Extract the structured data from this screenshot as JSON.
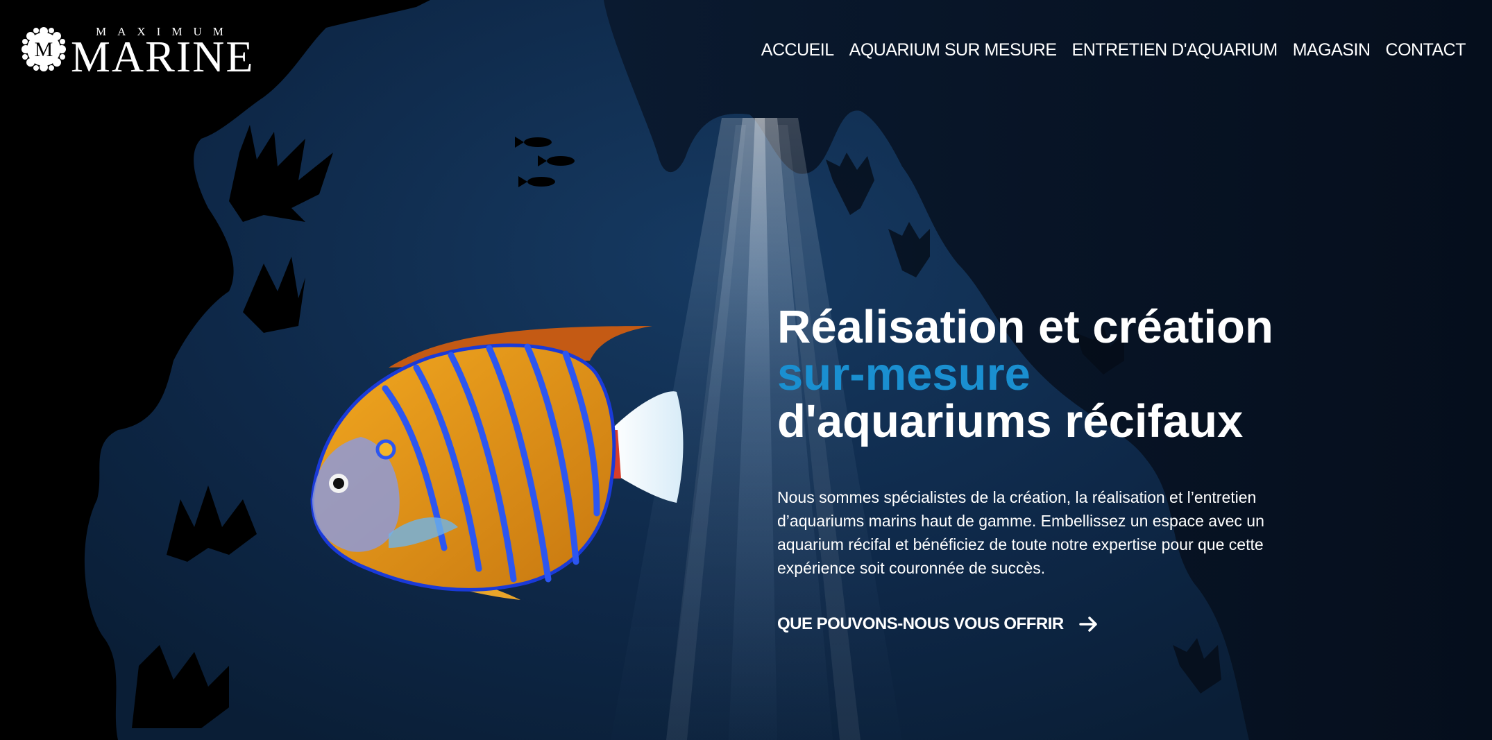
{
  "brand": {
    "small": "MAXIMUM",
    "name": "MARINE",
    "emblem_letter": "M"
  },
  "nav": {
    "items": [
      {
        "label": "ACCUEIL"
      },
      {
        "label": "AQUARIUM SUR MESURE"
      },
      {
        "label": "ENTRETIEN D'AQUARIUM"
      },
      {
        "label": "MAGASIN"
      },
      {
        "label": "CONTACT"
      }
    ]
  },
  "hero": {
    "line1": "Réalisation et création",
    "line2": "sur-mesure",
    "line3": "d'aquariums récifaux",
    "description": "Nous sommes spécialistes de la création, la réalisation et l’entretien d’aquariums marins haut de gamme. Embellissez un espace avec un aquarium récifal et bénéficiez de toute notre expertise pour que cette expérience soit couronnée de succès.",
    "cta": "QUE POUVONS-NOUS VOUS OFFRIR",
    "cta_icon": "arrow-right-icon"
  },
  "colors": {
    "background": "#000000",
    "water": "#0d2340",
    "accent": "#1a8fd0",
    "text": "#ffffff"
  }
}
